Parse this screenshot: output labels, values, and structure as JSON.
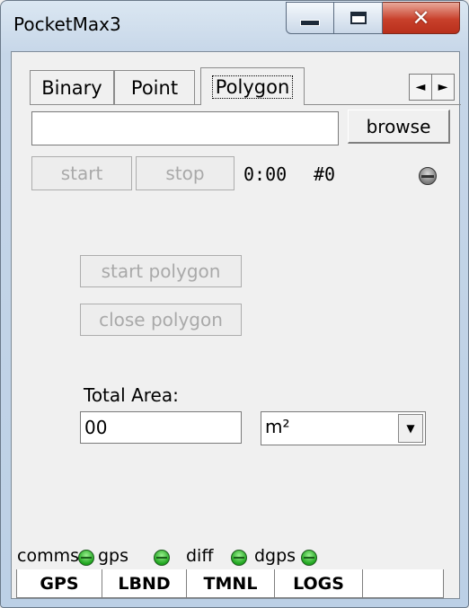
{
  "window": {
    "title": "PocketMax3"
  },
  "caption_buttons": {
    "minimize": "minimize-icon",
    "maximize": "maximize-icon",
    "close": "close-icon"
  },
  "tabs": [
    {
      "label": "Binary",
      "active": false
    },
    {
      "label": "Point",
      "active": false
    },
    {
      "label": "Polygon",
      "active": true
    }
  ],
  "tab_scroll": {
    "left": "◄",
    "right": "►"
  },
  "file": {
    "path_value": "",
    "browse_label": "browse"
  },
  "logging": {
    "start_label": "start",
    "stop_label": "stop",
    "elapsed": "0:00",
    "count": "#0",
    "indicator": "gray"
  },
  "polygon": {
    "start_label": "start polygon",
    "close_label": "close polygon",
    "total_area_label": "Total Area:",
    "area_value": "00",
    "unit_selected": "m²"
  },
  "status": [
    {
      "label": "comms",
      "state": "green"
    },
    {
      "label": "gps",
      "state": "green"
    },
    {
      "label": "diff",
      "state": "green"
    },
    {
      "label": "dgps",
      "state": "green"
    }
  ],
  "bottom_tabs": [
    "GPS",
    "LBND",
    "TMNL",
    "LOGS",
    ""
  ],
  "colors": {
    "led_green": "#1fa51f",
    "close_button": "#c8402b",
    "window_frame": "#c6d6e8"
  }
}
